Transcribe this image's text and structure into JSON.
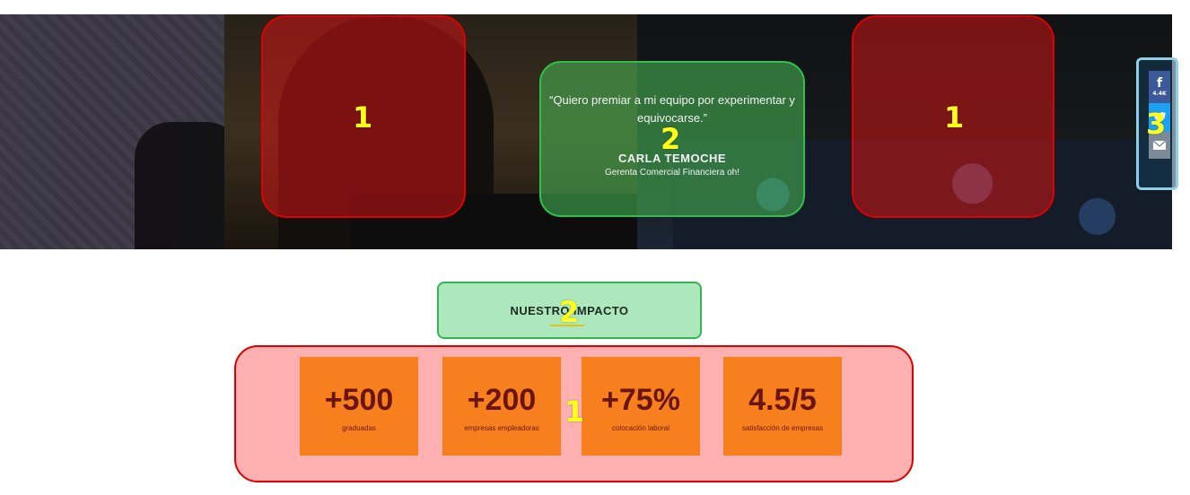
{
  "hero": {
    "quote": "“Quiero premiar a mi equipo por experimentar y equivocarse.”",
    "name": "CARLA TEMOCHE",
    "role": "Gerenta Comercial Financiera oh!"
  },
  "share": {
    "facebook_icon": "facebook-icon",
    "facebook_count": "4.4K",
    "twitter_icon": "twitter-icon",
    "email_icon": "envelope-icon"
  },
  "section": {
    "title": "NUESTRO IMPACTO"
  },
  "stats": [
    {
      "value": "+500",
      "label": "graduadas"
    },
    {
      "value": "+200",
      "label": "empresas empleadoras"
    },
    {
      "value": "+75%",
      "label": "colocación laboral"
    },
    {
      "value": "4.5/5",
      "label": "satisfacción de empresas"
    }
  ],
  "annotations": {
    "face_left": "1",
    "face_right": "1",
    "quote": "2",
    "share": "3",
    "title": "2",
    "stats": "1"
  },
  "colors": {
    "stat_card": "#f77f1e",
    "stat_text": "#6a1414",
    "mark": "#ffff1a",
    "face_box": "#e00000",
    "quote_box": "#2fbf4a",
    "share_box": "#8ecfe6"
  }
}
